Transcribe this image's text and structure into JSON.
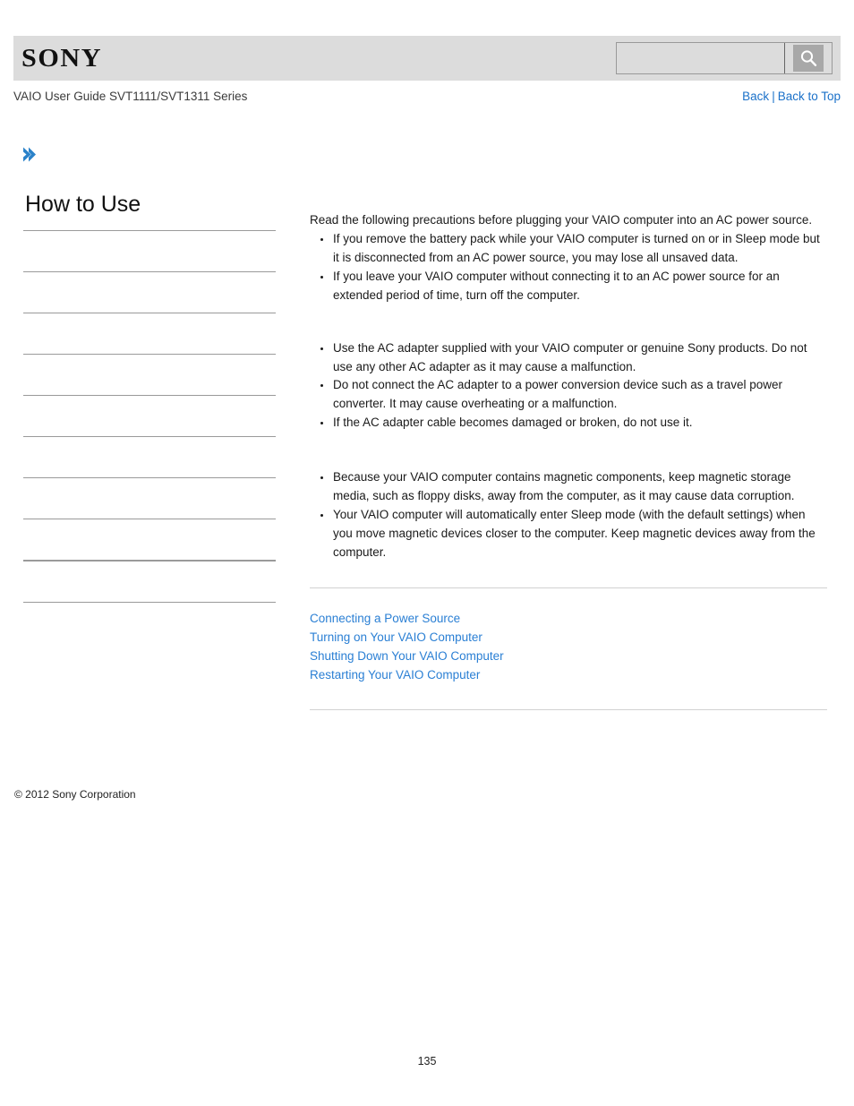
{
  "header": {
    "logo_text": "SONY",
    "search": {
      "value": "",
      "placeholder": "",
      "icon": "search-icon"
    }
  },
  "nav": {
    "guide_title": "VAIO User Guide SVT1111/SVT1311 Series",
    "back_label": "Back",
    "separator": "|",
    "back_to_top_label": "Back to Top"
  },
  "breadcrumb": {
    "icon": "chevron-right-icon",
    "text": ""
  },
  "sidebar": {
    "title": "How to Use",
    "items": [
      {
        "label": ""
      },
      {
        "label": ""
      },
      {
        "label": ""
      },
      {
        "label": ""
      },
      {
        "label": ""
      },
      {
        "label": ""
      },
      {
        "label": ""
      },
      {
        "label": ""
      },
      {
        "label": ""
      }
    ]
  },
  "main": {
    "intro": "Read the following precautions before plugging your VAIO computer into an AC power source.",
    "groups": [
      {
        "bullets": [
          "If you remove the battery pack while your VAIO computer is turned on or in Sleep mode but it is disconnected from an AC power source, you may lose all unsaved data.",
          "If you leave your VAIO computer without connecting it to an AC power source for an extended period of time, turn off the computer."
        ]
      },
      {
        "bullets": [
          "Use the AC adapter supplied with your VAIO computer or genuine Sony products. Do not use any other AC adapter as it may cause a malfunction.",
          "Do not connect the AC adapter to a power conversion device such as a travel power converter. It may cause overheating or a malfunction.",
          "If the AC adapter cable becomes damaged or broken, do not use it."
        ]
      },
      {
        "bullets": [
          "Because your VAIO computer contains magnetic components, keep magnetic storage media, such as floppy disks, away from the computer, as it may cause data corruption.",
          "Your VAIO computer will automatically enter Sleep mode (with the default settings) when you move magnetic devices closer to the computer. Keep magnetic devices away from the computer."
        ]
      }
    ],
    "related_links": [
      "Connecting a Power Source",
      "Turning on Your VAIO Computer",
      "Shutting Down Your VAIO Computer",
      "Restarting Your VAIO Computer"
    ]
  },
  "footer": {
    "copyright": "© 2012 Sony Corporation",
    "page_number": "135"
  },
  "colors": {
    "link": "#2a7fd4",
    "nav_link": "#1b71c9",
    "header_bg": "#dcdcdc",
    "rule": "#9a9a9a",
    "accent": "#2b82c9"
  }
}
